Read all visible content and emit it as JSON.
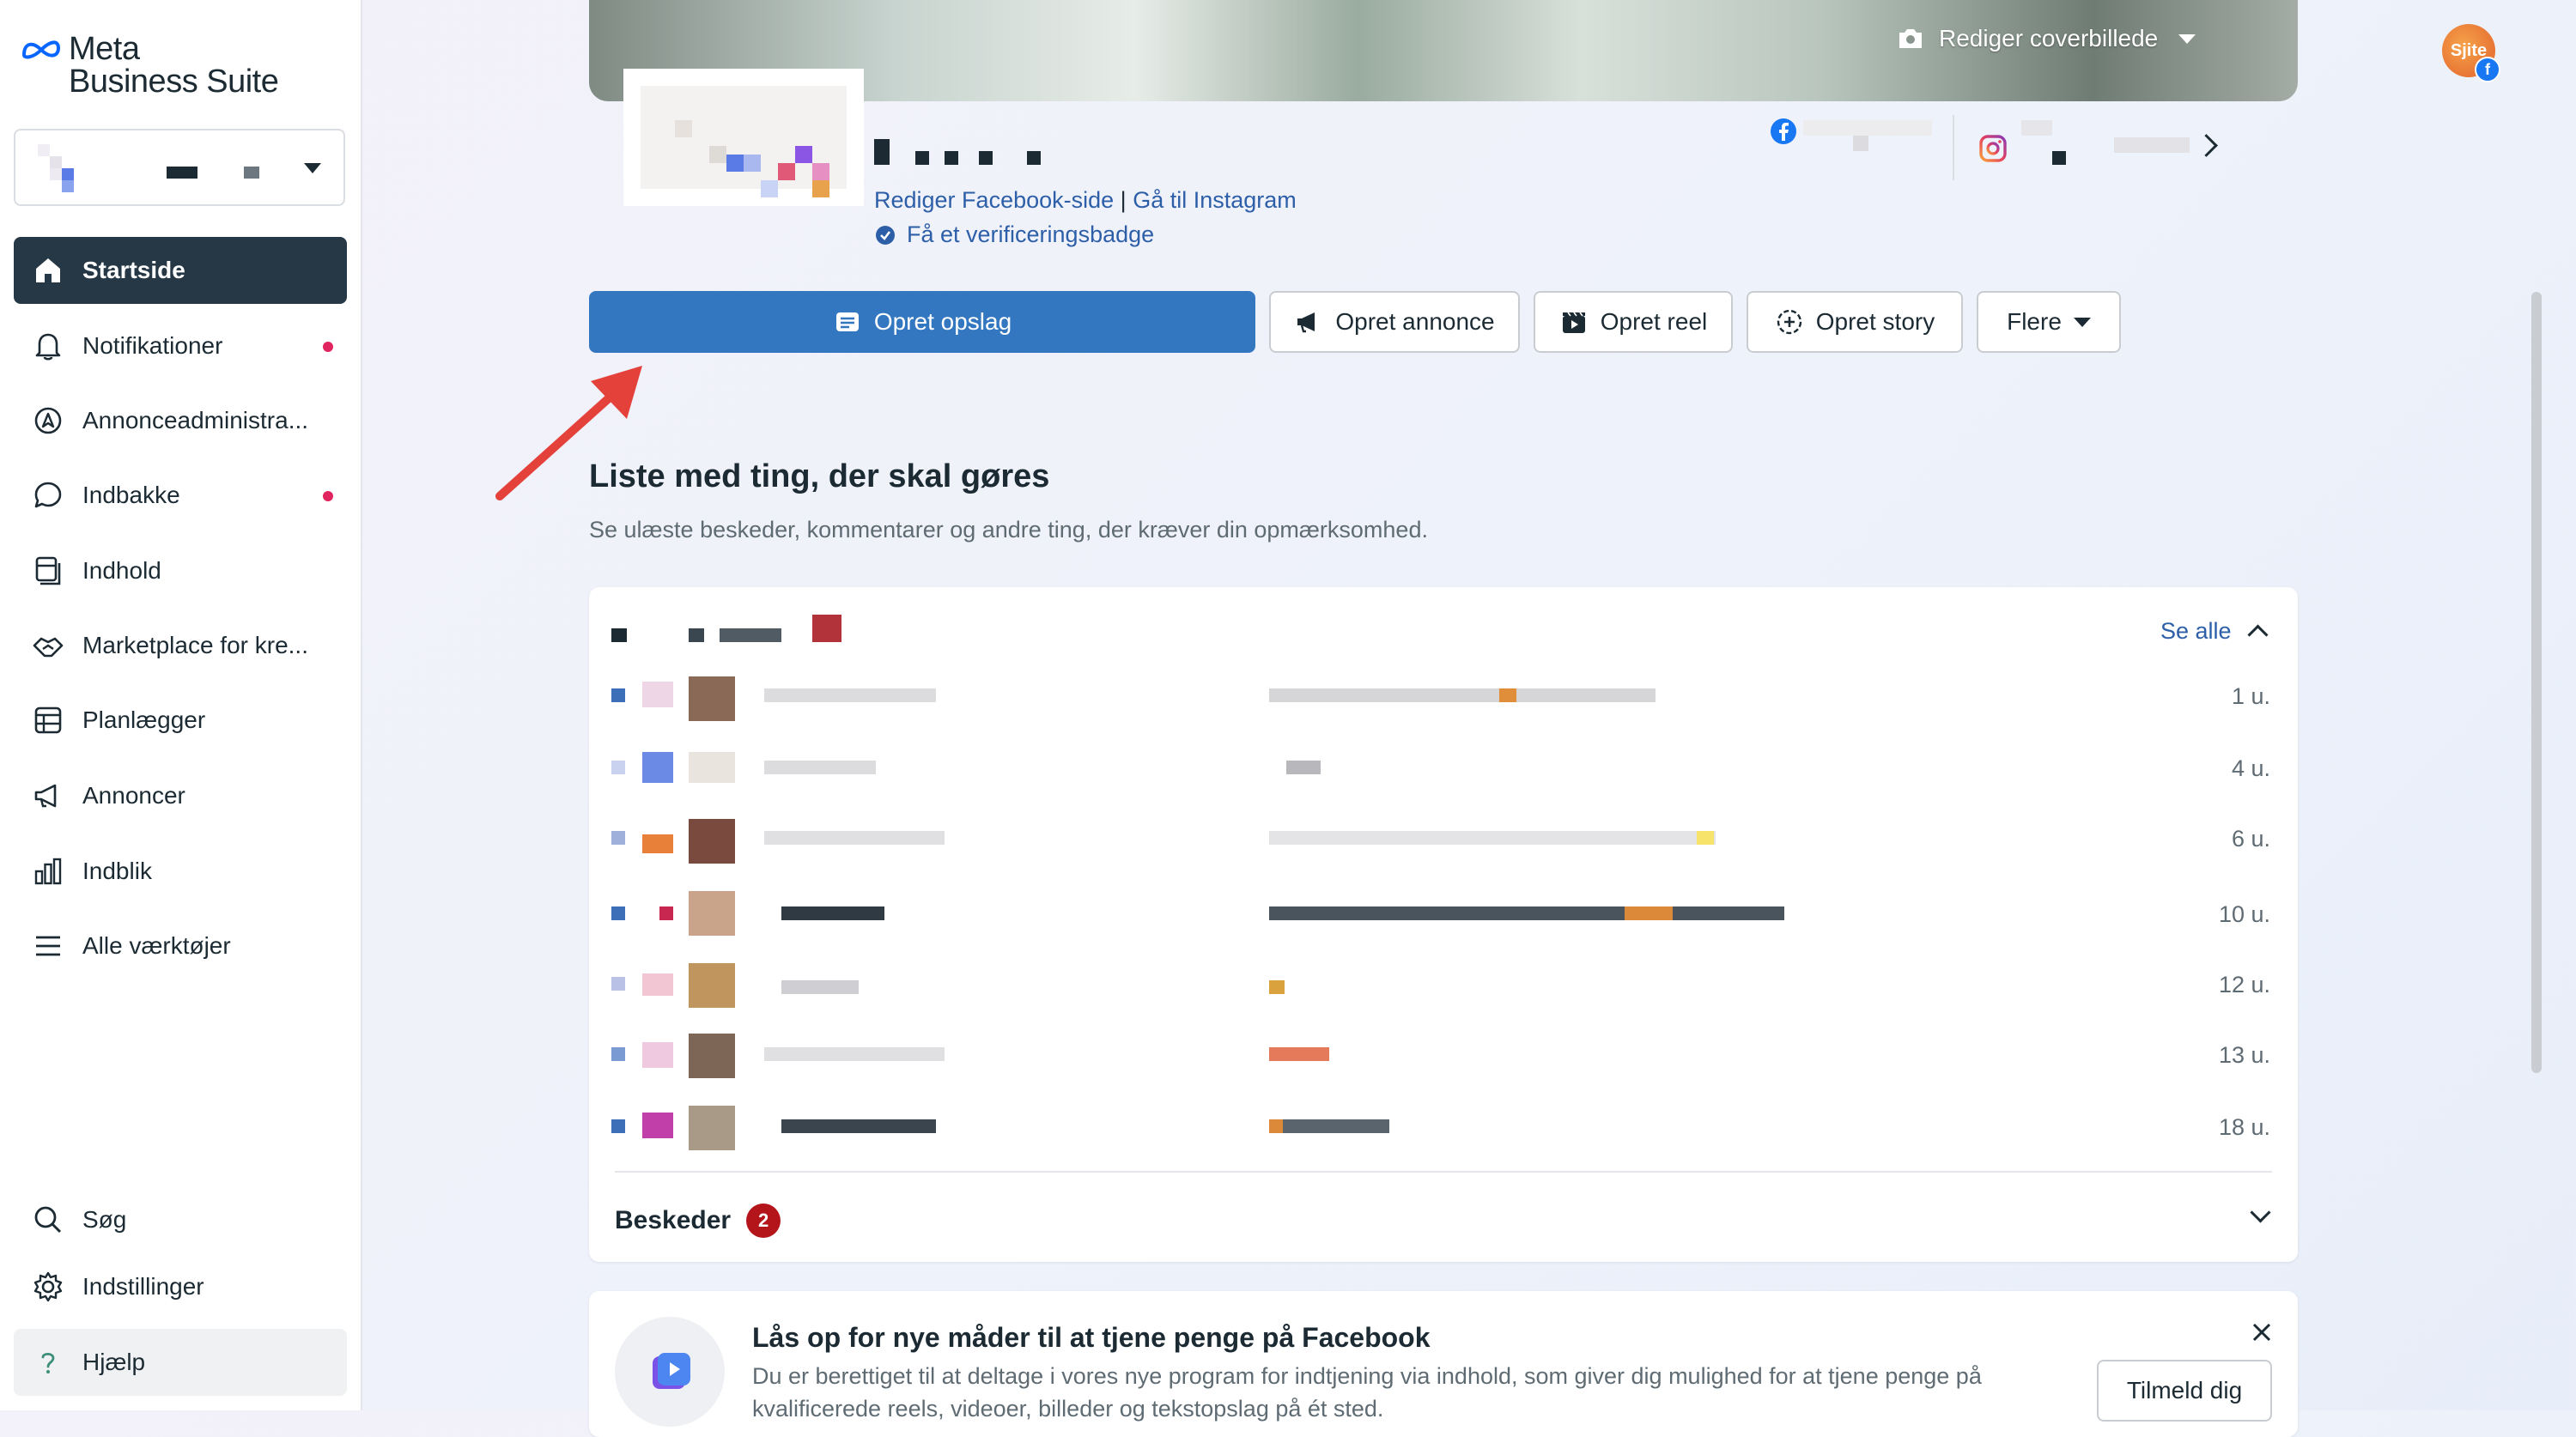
{
  "brand": {
    "line1": "Meta",
    "line2": "Business Suite"
  },
  "sidebar": {
    "items": [
      {
        "label": "Startside",
        "icon": "home-icon",
        "active": true
      },
      {
        "label": "Notifikationer",
        "icon": "bell-icon",
        "dot": true
      },
      {
        "label": "Annonceadministra...",
        "icon": "ads-manager-icon"
      },
      {
        "label": "Indbakke",
        "icon": "chat-bubble-icon",
        "dot": true
      },
      {
        "label": "Indhold",
        "icon": "content-icon"
      },
      {
        "label": "Marketplace for kre...",
        "icon": "handshake-icon"
      },
      {
        "label": "Planlægger",
        "icon": "calendar-grid-icon"
      },
      {
        "label": "Annoncer",
        "icon": "megaphone-icon"
      },
      {
        "label": "Indblik",
        "icon": "bar-chart-icon"
      },
      {
        "label": "Alle værktøjer",
        "icon": "menu-icon"
      }
    ],
    "bottom": [
      {
        "label": "Søg",
        "icon": "search-icon"
      },
      {
        "label": "Indstillinger",
        "icon": "gear-icon"
      },
      {
        "label": "Hjælp",
        "icon": "help-icon"
      }
    ]
  },
  "cover": {
    "edit_label": "Rediger coverbillede"
  },
  "avatar": {
    "text": "Sjite"
  },
  "profile": {
    "edit_fb_link": "Rediger Facebook-side",
    "separator": " | ",
    "goto_ig_link": "Gå til Instagram",
    "verify_link": "Få et verificeringsbadge"
  },
  "actions": {
    "create_post": "Opret opslag",
    "create_ad": "Opret annonce",
    "create_reel": "Opret reel",
    "create_story": "Opret story",
    "more": "Flere"
  },
  "todo": {
    "title": "Liste med ting, der skal gøres",
    "subtitle": "Se ulæste beskeder, kommentarer og andre ting, der kræver din opmærksomhed.",
    "see_all": "Se alle",
    "rows": [
      {
        "time": "1 u."
      },
      {
        "time": "4 u."
      },
      {
        "time": "6 u."
      },
      {
        "time": "10 u."
      },
      {
        "time": "12 u."
      },
      {
        "time": "13 u."
      },
      {
        "time": "18 u."
      }
    ],
    "messages_label": "Beskeder",
    "messages_count": "2"
  },
  "promo": {
    "title": "Lås op for nye måder til at tjene penge på Facebook",
    "body": "Du er berettiget til at deltage i vores nye program for indtjening via indhold, som giver dig mulighed for at tjene penge på kvalificerede reels, videoer, billeder og tekstopslag på ét sted.",
    "cta": "Tilmeld dig"
  },
  "colors": {
    "primary": "#3377c1",
    "nav_active": "#263846",
    "badge": "#b3151b",
    "link": "#2d5fa8"
  }
}
